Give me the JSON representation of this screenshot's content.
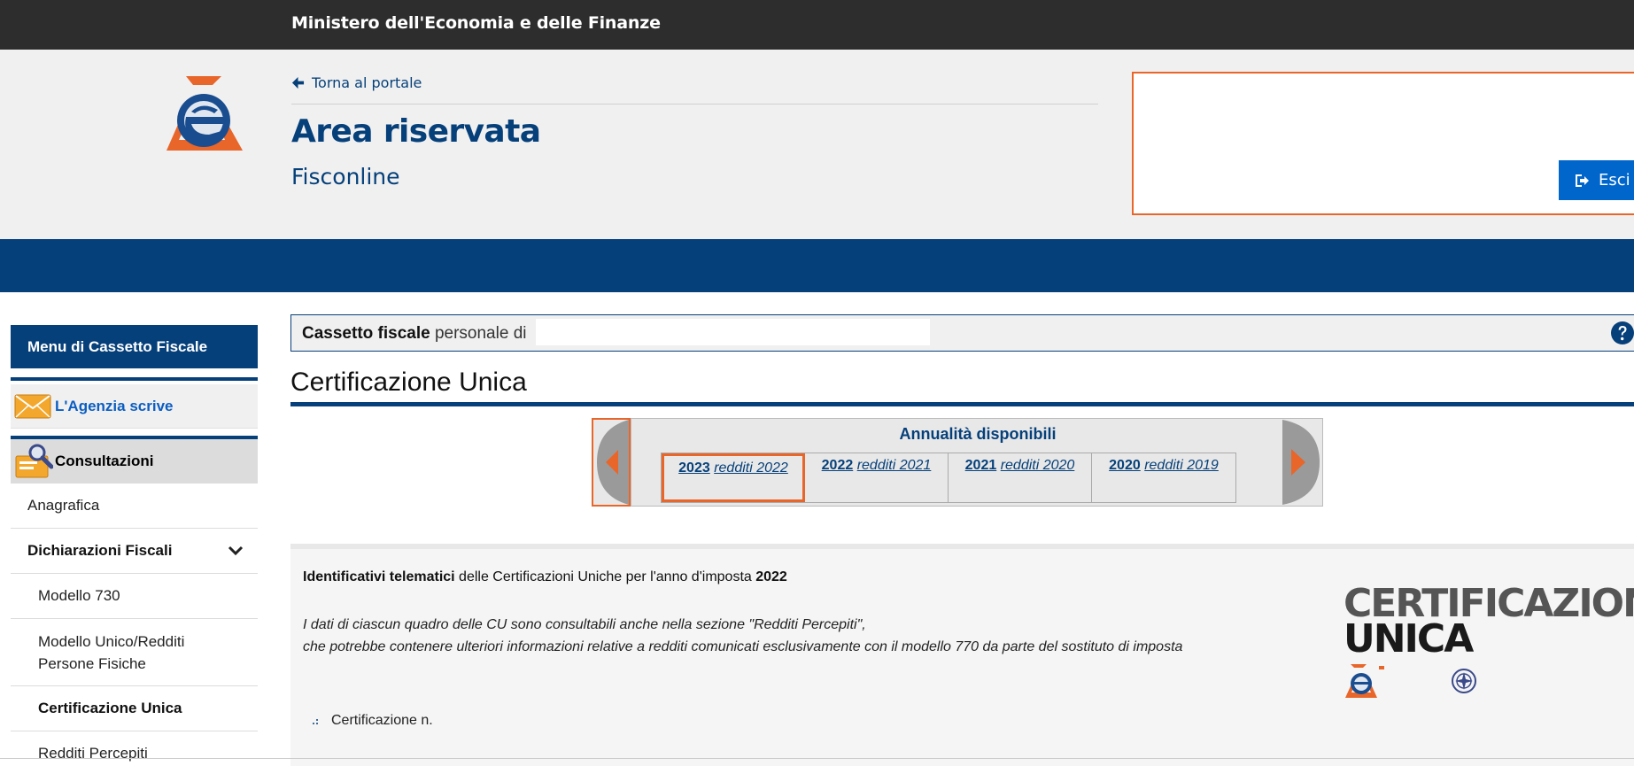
{
  "topbar": {
    "ministry": "Ministero dell'Economia e delle Finanze"
  },
  "header": {
    "back_link": "Torna al portale",
    "title": "Area riservata",
    "subtitle": "Fisconline",
    "logout_label": "Esci"
  },
  "sidebar": {
    "menu_title": "Menu di Cassetto Fiscale",
    "agenzia_scrive": "L'Agenzia scrive",
    "consultazioni": "Consultazioni",
    "items": [
      {
        "label": "Anagrafica"
      },
      {
        "label": "Dichiarazioni Fiscali"
      },
      {
        "label": "Modello 730"
      },
      {
        "label": "Modello Unico/Redditi Persone Fisiche"
      },
      {
        "label": "Certificazione Unica"
      },
      {
        "label": "Redditi Percepiti"
      }
    ]
  },
  "main": {
    "cassetto_bold": "Cassetto fiscale",
    "cassetto_rest": " personale di",
    "page_title": "Certificazione Unica",
    "annualita_title": "Annualità disponibili",
    "years": [
      {
        "year": "2023",
        "label": "redditi 2022"
      },
      {
        "year": "2022",
        "label": "redditi 2021"
      },
      {
        "year": "2021",
        "label": "redditi 2020"
      },
      {
        "year": "2020",
        "label": "redditi 2019"
      }
    ],
    "ident_bold": "Identificativi telematici",
    "ident_mid": " delle Certificazioni Uniche per l'anno d'imposta ",
    "ident_year": "2022",
    "note_line1": "I dati di ciascun quadro delle CU sono consultabili anche nella sezione \"Redditi Percepiti\",",
    "note_line2": "che potrebbe contenere ulteriori informazioni relative a redditi comunicati esclusivamente con il modello 770 da parte del sostituto di imposta",
    "cert_item": "Certificazione n.",
    "cu_logo_line1": "CERTIFICAZIONE",
    "cu_logo_line2": "UNICA"
  },
  "colors": {
    "brand_blue": "#06407a",
    "accent_orange": "#e8662a",
    "button_blue": "#0066cc"
  }
}
